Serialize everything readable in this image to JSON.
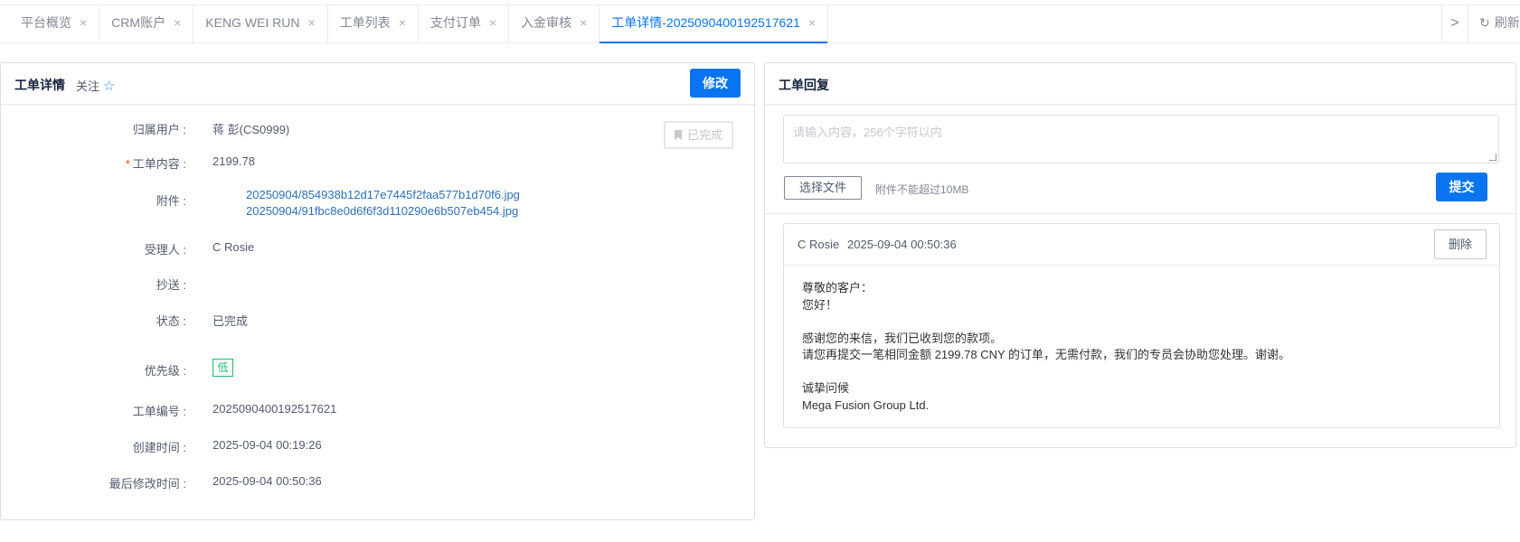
{
  "tabs": [
    {
      "label": "平台概览",
      "active": false
    },
    {
      "label": "CRM账户",
      "active": false
    },
    {
      "label": "KENG WEI RUN",
      "active": false
    },
    {
      "label": "工单列表",
      "active": false
    },
    {
      "label": "支付订单",
      "active": false
    },
    {
      "label": "入金审核",
      "active": false
    },
    {
      "label": "工单详情-2025090400192517621",
      "active": true
    }
  ],
  "tab_close_glyph": "×",
  "tab_next_glyph": ">",
  "refresh_label": "刷新",
  "detail": {
    "title": "工单详情",
    "follow_label": "关注",
    "edit_label": "修改",
    "status_stamp": "已完成",
    "labels": {
      "user": "归属用户 :",
      "content": "工单内容 :",
      "attachments": "附件 :",
      "assignee": "受理人 :",
      "cc": "抄送 :",
      "status": "状态 :",
      "priority": "优先级 :",
      "ticket_no": "工单编号 :",
      "created": "创建时间 :",
      "modified": "最后修改时间 :"
    },
    "user": "蒋 彭(CS0999)",
    "content": "2199.78",
    "attachments": [
      "20250904/854938b12d17e7445f2faa577b1d70f6.jpg",
      "20250904/91fbc8e0d6f6f3d110290e6b507eb454.jpg"
    ],
    "assignee": "C Rosie",
    "cc": "",
    "status": "已完成",
    "priority": "低",
    "ticket_no": "2025090400192517621",
    "created": "2025-09-04 00:19:26",
    "modified": "2025-09-04 00:50:36"
  },
  "reply": {
    "title": "工单回复",
    "placeholder": "请输入内容，256个字符以内",
    "choose_file_label": "选择文件",
    "attach_hint": "附件不能超过10MB",
    "submit_label": "提交",
    "items": [
      {
        "author": "C Rosie",
        "time": "2025-09-04 00:50:36",
        "delete_label": "删除",
        "lines": [
          "尊敬的客户：",
          "您好！",
          "",
          "感谢您的来信，我们已收到您的款项。",
          "请您再提交一笔相同金额 2199.78 CNY 的订单，无需付款，我们的专员会协助您处理。谢谢。",
          "",
          "诚挚问候",
          "Mega Fusion Group Ltd."
        ]
      }
    ]
  },
  "colors": {
    "accent": "#0a74f0",
    "priority_low": "#19be6b",
    "required": "#ed4014",
    "link": "#2d6fb8"
  }
}
